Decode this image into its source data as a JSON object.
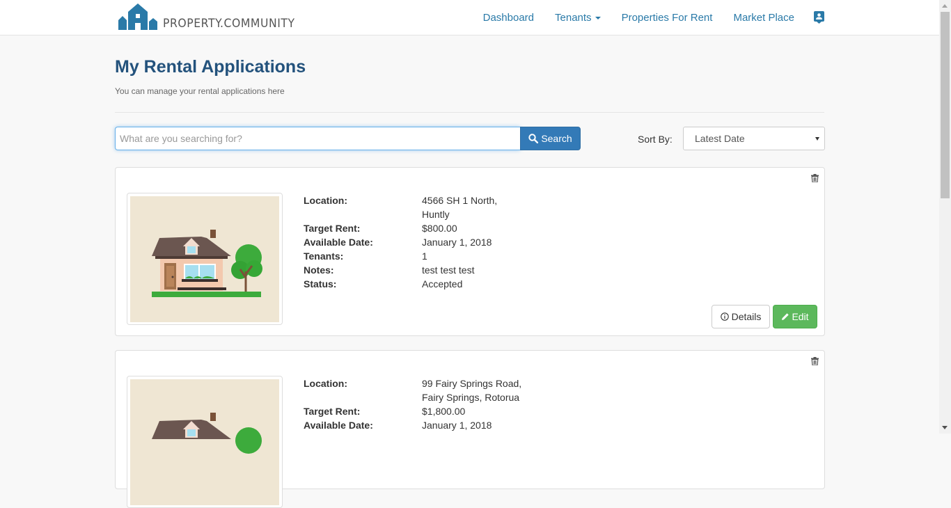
{
  "brand": {
    "name": "PROPERTY.COMMUNITY",
    "color": "#2a7aa8"
  },
  "nav": {
    "items": [
      {
        "label": "Dashboard"
      },
      {
        "label": "Tenants"
      },
      {
        "label": "Properties For Rent"
      },
      {
        "label": "Market Place"
      }
    ],
    "profile_icon": "contact-card-icon"
  },
  "page": {
    "title": "My Rental Applications",
    "subtitle": "You can manage your rental applications here"
  },
  "search": {
    "placeholder": "What are you searching for?",
    "value": "",
    "button_label": "Search",
    "button_icon": "search-icon"
  },
  "sort": {
    "label": "Sort By:",
    "selected": "Latest Date"
  },
  "field_labels": {
    "location": "Location:",
    "target_rent": "Target Rent:",
    "available_date": "Available Date:",
    "tenants": "Tenants:",
    "notes": "Notes:",
    "status": "Status:"
  },
  "applications": [
    {
      "location_line1": "4566 SH 1 North,",
      "location_line2": "Huntly",
      "target_rent": "$800.00",
      "available_date": "January 1, 2018",
      "tenants": "1",
      "notes": "test test test",
      "status": "Accepted",
      "details_label": "Details",
      "edit_label": "Edit"
    },
    {
      "location_line1": "99 Fairy Springs Road,",
      "location_line2": "Fairy Springs, Rotorua",
      "target_rent": "$1,800.00",
      "available_date": "January 1, 2018"
    }
  ],
  "colors": {
    "primary": "#337ab7",
    "success": "#5cb85c",
    "title": "#23527c",
    "link": "#2a7aa8"
  }
}
